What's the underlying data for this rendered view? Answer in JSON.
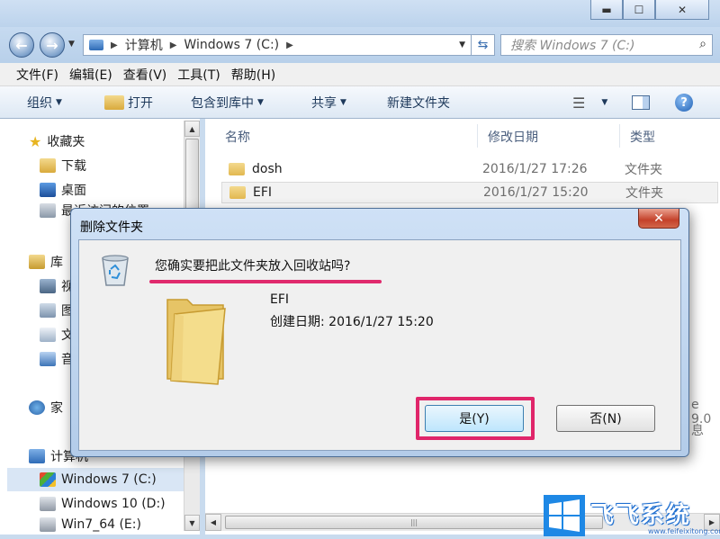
{
  "window": {
    "controls": {
      "minimize": "▬",
      "maximize": "☐",
      "close": "✕"
    }
  },
  "address": {
    "back": "←",
    "forward": "→",
    "path": [
      "计算机",
      "Windows 7 (C:)"
    ],
    "search_placeholder": "搜索 Windows 7 (C:)"
  },
  "menu": [
    "文件(F)",
    "编辑(E)",
    "查看(V)",
    "工具(T)",
    "帮助(H)"
  ],
  "toolbar": {
    "organize": "组织",
    "open": "打开",
    "include": "包含到库中",
    "share": "共享",
    "new_folder": "新建文件夹"
  },
  "nav": {
    "favorites": "收藏夹",
    "downloads": "下载",
    "desktop": "桌面",
    "recent": "最近访问的位置",
    "libraries": "库",
    "lib_video": "视",
    "lib_pictures": "图",
    "lib_docs": "文",
    "lib_music": "音",
    "homegroup": "家",
    "computer": "计算机",
    "drives": [
      {
        "label": "Windows 7 (C:)",
        "selected": true
      },
      {
        "label": "Windows 10 (D:)",
        "selected": false
      },
      {
        "label": "Win7_64 (E:)",
        "selected": false
      }
    ]
  },
  "files": {
    "headers": {
      "name": "名称",
      "modified": "修改日期",
      "type": "类型"
    },
    "rows": [
      {
        "name": "dosh",
        "modified": "2016/1/27 17:26",
        "type": "文件夹"
      },
      {
        "name": "EFI",
        "modified": "2016/1/27 15:20",
        "type": "文件夹"
      }
    ],
    "peek_right_1": "e 9.0",
    "peek_right_2": "息"
  },
  "dialog": {
    "title": "删除文件夹",
    "close": "✕",
    "question": "您确实要把此文件夹放入回收站吗?",
    "item_name": "EFI",
    "item_created": "创建日期: 2016/1/27 15:20",
    "yes": "是(Y)",
    "no": "否(N)"
  },
  "colors": {
    "highlight": "#e0256a",
    "titlebar": "#c6daf0",
    "primary_button": "#bee6fd"
  },
  "watermark": {
    "text": "飞飞系统",
    "url": "www.feifeixitong.com"
  }
}
